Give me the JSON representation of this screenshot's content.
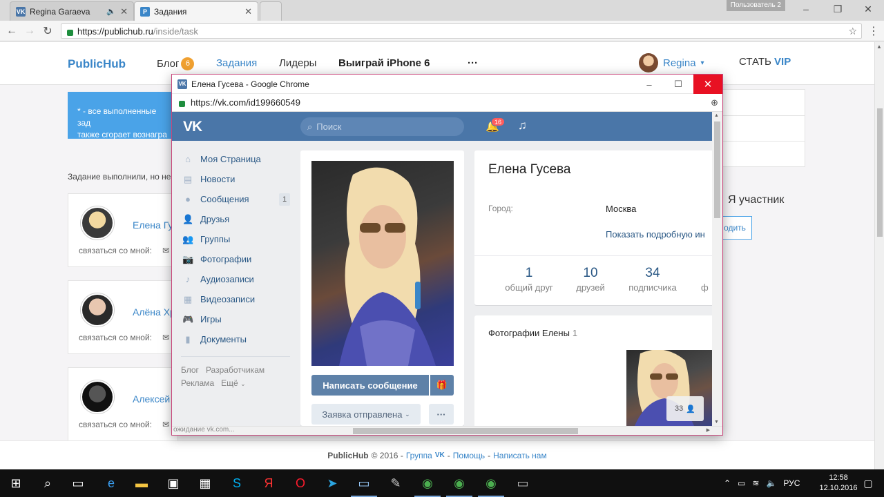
{
  "browser": {
    "tabs": [
      {
        "label": "Regina Garaeva",
        "favicon": "vk-icon"
      },
      {
        "label": "Задания",
        "favicon": "publichub-icon"
      }
    ],
    "user_badge": "Пользователь 2",
    "url_host": "https://publichub.ru",
    "url_path": "/inside/task"
  },
  "site": {
    "logo": "PublicHub",
    "nav": {
      "blog": "Блог",
      "blog_badge": "6",
      "tasks": "Задания",
      "leaders": "Лидеры",
      "win": "Выиграй",
      "win_apple": "",
      "win_product": "iPhone 6",
      "more": "···"
    },
    "user": {
      "name": "Regina",
      "caret": "▾"
    },
    "vip": {
      "prefix": "СТАТЬ",
      "accent": "VIP"
    },
    "notice_line1": "* - все выполненные зад",
    "notice_line2": "также сгорает вознагра",
    "done_text": "Задание выполнили, но не",
    "cards": [
      {
        "name": "Елена Гу",
        "contact": "связаться со мной:"
      },
      {
        "name": "Алёна Хр",
        "contact": "связаться со мной:"
      },
      {
        "name": "Алексей",
        "contact": "связаться со мной:"
      }
    ],
    "member_label": "Я участник",
    "join_label": "одить",
    "footer": {
      "brand": "PublicHub",
      "copy": "© 2016 -",
      "group": "Группа",
      "dash": "-",
      "help": "Помощь",
      "write": "Написать нам"
    }
  },
  "popup": {
    "window_title": "Елена Гусева - Google Chrome",
    "url": "https://vk.com/id199660549",
    "vk": {
      "logo": "VK",
      "search_placeholder": "Поиск",
      "notif_count": "16",
      "menu": [
        {
          "label": "Моя Страница",
          "icon": "home-icon",
          "count": ""
        },
        {
          "label": "Новости",
          "icon": "news-icon",
          "count": ""
        },
        {
          "label": "Сообщения",
          "icon": "messages-icon",
          "count": "1"
        },
        {
          "label": "Друзья",
          "icon": "friends-icon",
          "count": ""
        },
        {
          "label": "Группы",
          "icon": "groups-icon",
          "count": ""
        },
        {
          "label": "Фотографии",
          "icon": "camera-icon",
          "count": ""
        },
        {
          "label": "Аудиозаписи",
          "icon": "music-icon",
          "count": ""
        },
        {
          "label": "Видеозаписи",
          "icon": "video-icon",
          "count": ""
        },
        {
          "label": "Игры",
          "icon": "gamepad-icon",
          "count": ""
        },
        {
          "label": "Документы",
          "icon": "document-icon",
          "count": ""
        }
      ],
      "footer_links": {
        "blog": "Блог",
        "dev": "Разработчикам",
        "ads": "Реклама",
        "more": "Ещё"
      },
      "send_message": "Написать сообщение",
      "request_sent": "Заявка отправлена",
      "profile": {
        "name": "Елена Гусева",
        "city_label": "Город:",
        "city": "Москва",
        "show_more": "Показать подробную ин",
        "stats": [
          {
            "n": "1",
            "label": "общий друг"
          },
          {
            "n": "10",
            "label": "друзей"
          },
          {
            "n": "34",
            "label": "подписчика"
          }
        ],
        "stat_cut": "ф"
      },
      "photos_title": "Фотографии Елены",
      "photos_count": "1",
      "thumb_count": "33",
      "status_text": "ожидание vk.com..."
    }
  },
  "taskbar": {
    "lang": "РУС",
    "time": "12:58",
    "date": "12.10.2016"
  }
}
